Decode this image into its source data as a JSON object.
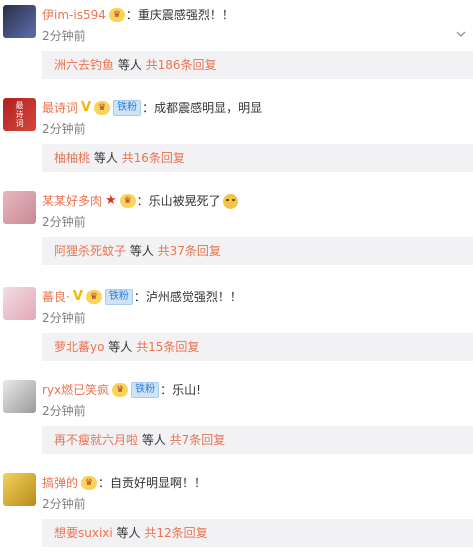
{
  "comments": [
    {
      "username": "伊im-is594",
      "badges": [
        "vip"
      ],
      "text": "：重庆震感强烈！！",
      "time": "2分钟前",
      "reply_name": "洲六去钓鱼",
      "reply_mid": " 等人 ",
      "reply_count": "共186条回复",
      "avatar_colors": [
        "#2b2f45",
        "#5d6fb0"
      ]
    },
    {
      "username": "最诗词",
      "badges": [
        "v",
        "vip",
        "fan"
      ],
      "fan_label": "铁粉",
      "text": "：成都震感明显，明显",
      "time": "2分钟前",
      "reply_name": "柚柚桃",
      "reply_mid": " 等人 ",
      "reply_count": "共16条回复",
      "avatar_colors": [
        "#b0211f",
        "#d4473d"
      ],
      "avatar_text": "最诗词"
    },
    {
      "username": "某某好多肉",
      "badges": [
        "star",
        "vip"
      ],
      "text": "：乐山被晃死了",
      "time": "2分钟前",
      "reply_name": "阿狸杀死蚊子",
      "reply_mid": " 等人 ",
      "reply_count": "共37条回复",
      "avatar_colors": [
        "#e7b6bf",
        "#c98a95"
      ]
    },
    {
      "username": "蕃良·",
      "badges": [
        "v",
        "vip",
        "fan"
      ],
      "fan_label": "铁粉",
      "text": "：泸州感觉强烈！！",
      "time": "2分钟前",
      "reply_name": "萝北蕃yo",
      "reply_mid": " 等人 ",
      "reply_count": "共15条回复",
      "avatar_colors": [
        "#f3dce3",
        "#e2a9b9"
      ]
    },
    {
      "username": "ryx燃已笑疯",
      "badges": [
        "vip",
        "fan"
      ],
      "fan_label": "铁粉",
      "text": "：乐山!",
      "time": "2分钟前",
      "reply_name": "再不瘦就六月啦",
      "reply_mid": " 等人 ",
      "reply_count": "共7条回复",
      "avatar_colors": [
        "#e9e9e9",
        "#9a9a9a"
      ]
    },
    {
      "username": "搞弹的",
      "badges": [
        "vip"
      ],
      "text": "：自贡好明显啊！！",
      "time": "2分钟前",
      "reply_name": "想要suxixi",
      "reply_mid": " 等人 ",
      "reply_count": "共12条回复",
      "avatar_colors": [
        "#f1d45a",
        "#b88a1c"
      ]
    }
  ],
  "colors": {
    "username": "#eb7350",
    "reply_bg": "#f2f2f5",
    "time": "#808080"
  },
  "icons": {
    "more": "chevron-down-icon",
    "vip": "vip-crown-icon",
    "v": "verified-v-icon",
    "star": "star-icon"
  }
}
